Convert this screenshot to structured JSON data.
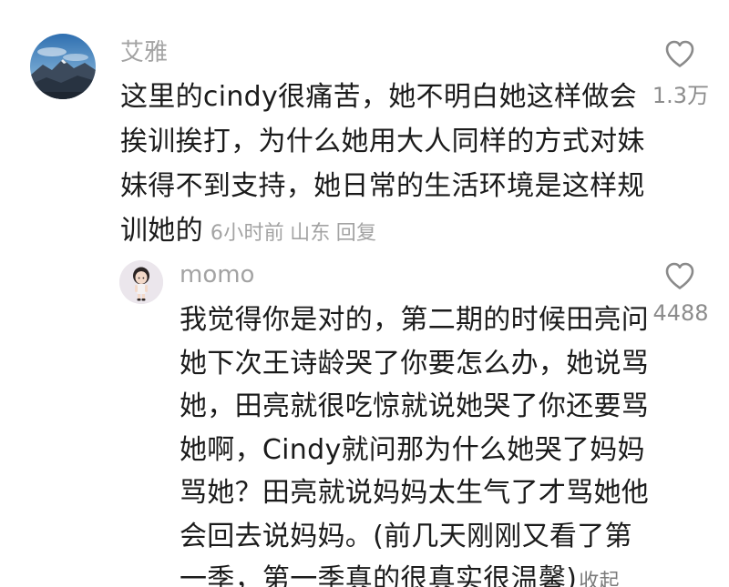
{
  "comment": {
    "username": "艾雅",
    "lines": [
      "这里的cindy很痛苦，她不明白她这样做会",
      "挨训挨打，为什么她用大人同样的方式对妹",
      "妹得不到支持，她日常的生活环境是这样规",
      "训她的"
    ],
    "time": "6小时前",
    "location": "山东",
    "reply_label": "回复",
    "like_count": "1.3万",
    "avatar_icon": "mountain-landscape-avatar"
  },
  "reply": {
    "username": "momo",
    "lines": [
      "我觉得你是对的，第二期的时候田亮问",
      "她下次王诗龄哭了你要怎么办，她说骂",
      "她，田亮就很吃惊就说她哭了你还要骂",
      "她啊，Cindy就问那为什么她哭了妈妈",
      "骂她？田亮就说妈妈太生气了才骂她他",
      "会回去说妈妈。(前几天刚刚又看了第",
      "一季，第一季真的很真实很温馨)"
    ],
    "collapse_label": "收起",
    "like_count": "4488",
    "avatar_icon": "cartoon-girl-avatar"
  },
  "icons": {
    "like": "heart-outline-icon"
  },
  "colors": {
    "text": "#1b1b1b",
    "meta": "#a3a3a3",
    "collapse": "#7b7b7b"
  }
}
